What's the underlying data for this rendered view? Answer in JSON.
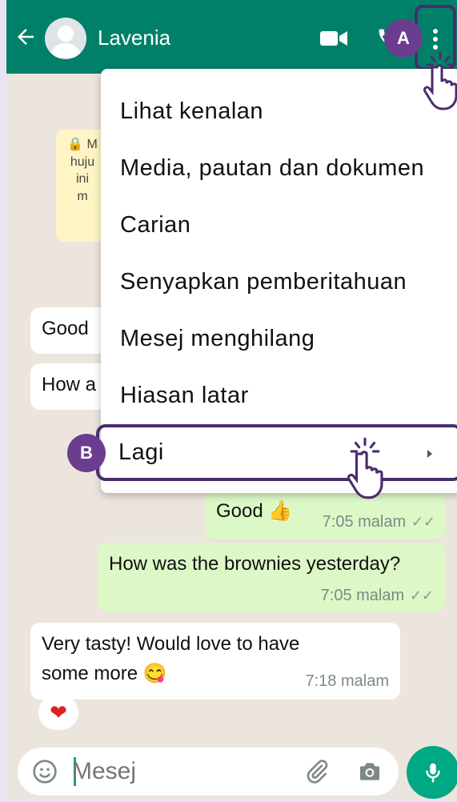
{
  "header": {
    "contact_name": "Lavenia",
    "background_color": "#008069"
  },
  "markers": {
    "a": "A",
    "b": "B"
  },
  "notice": {
    "lines": [
      "M",
      "huju",
      "ini",
      "m"
    ]
  },
  "messages": {
    "in_1": "Good",
    "in_2": "How a",
    "out_1": {
      "text": "Good",
      "time": "7:05 malam"
    },
    "out_2": {
      "text": "How was the brownies yesterday?",
      "time": "7:05 malam"
    },
    "in_3": {
      "line1": "Very tasty! Would love to have",
      "line2": "some more",
      "time": "7:18 malam"
    }
  },
  "menu": {
    "items": [
      "Lihat kenalan",
      "Media, pautan dan dokumen",
      "Carian",
      "Senyapkan pemberitahuan",
      "Mesej menghilang",
      "Hiasan latar",
      "Lagi"
    ]
  },
  "composer": {
    "placeholder": "Mesej"
  },
  "colors": {
    "accent": "#00a884",
    "highlight_border": "#4b2d6b",
    "marker": "#6b3d8f"
  },
  "icons": {
    "back": "arrow-left-icon",
    "video": "video-camera-icon",
    "call": "phone-icon",
    "menu": "more-vertical-icon",
    "emoji": "emoji-icon",
    "attach": "paperclip-icon",
    "camera": "camera-icon",
    "mic": "microphone-icon"
  }
}
